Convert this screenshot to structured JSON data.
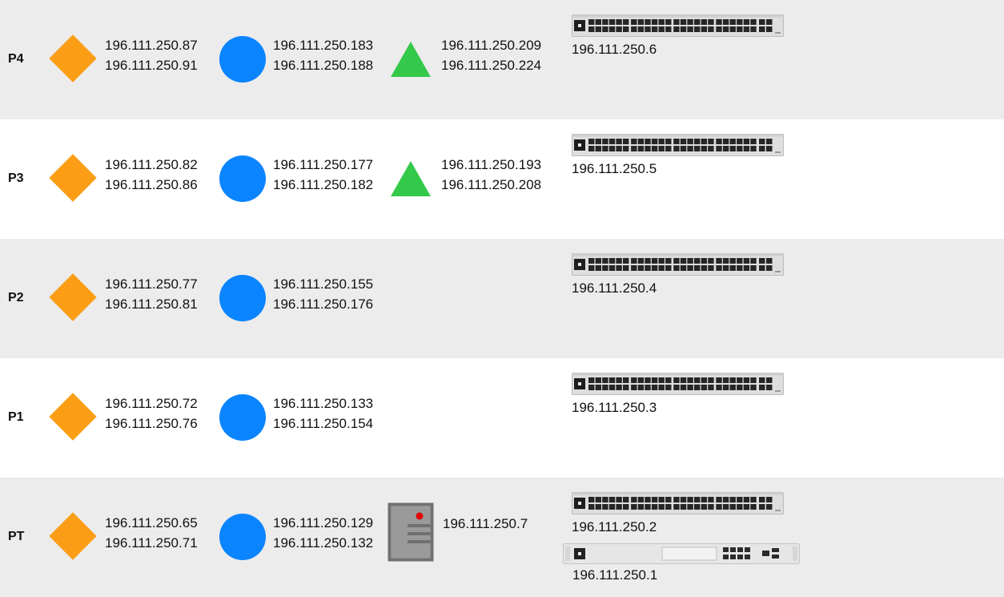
{
  "floors": [
    {
      "label": "P4",
      "diamond": [
        "196.111.250.87",
        "196.111.250.91"
      ],
      "circle": [
        "196.111.250.183",
        "196.111.250.188"
      ],
      "triangle": [
        "196.111.250.209",
        "196.111.250.224"
      ],
      "switch_ip": "196.111.250.6"
    },
    {
      "label": "P3",
      "diamond": [
        "196.111.250.82",
        "196.111.250.86"
      ],
      "circle": [
        "196.111.250.177",
        "196.111.250.182"
      ],
      "triangle": [
        "196.111.250.193",
        "196.111.250.208"
      ],
      "switch_ip": "196.111.250.5"
    },
    {
      "label": "P2",
      "diamond": [
        "196.111.250.77",
        "196.111.250.81"
      ],
      "circle": [
        "196.111.250.155",
        "196.111.250.176"
      ],
      "switch_ip": "196.111.250.4"
    },
    {
      "label": "P1",
      "diamond": [
        "196.111.250.72",
        "196.111.250.76"
      ],
      "circle": [
        "196.111.250.133",
        "196.111.250.154"
      ],
      "switch_ip": "196.111.250.3"
    },
    {
      "label": "PT",
      "diamond": [
        "196.111.250.65",
        "196.111.250.71"
      ],
      "circle": [
        "196.111.250.129",
        "196.111.250.132"
      ],
      "server_ip": "196.111.250.7",
      "switch_ip": "196.111.250.2",
      "gateway_ip": "196.111.250.1"
    }
  ],
  "colors": {
    "diamond": "#fb9e16",
    "circle": "#0a84ff",
    "triangle": "#34c94a",
    "server": "#8e8e8e",
    "shade": "#ececec"
  },
  "icons": {
    "diamond": "diamond-icon",
    "circle": "circle-icon",
    "triangle": "triangle-icon",
    "server": "server-icon",
    "switch": "network-switch-icon",
    "gateway": "gateway-router-icon"
  }
}
